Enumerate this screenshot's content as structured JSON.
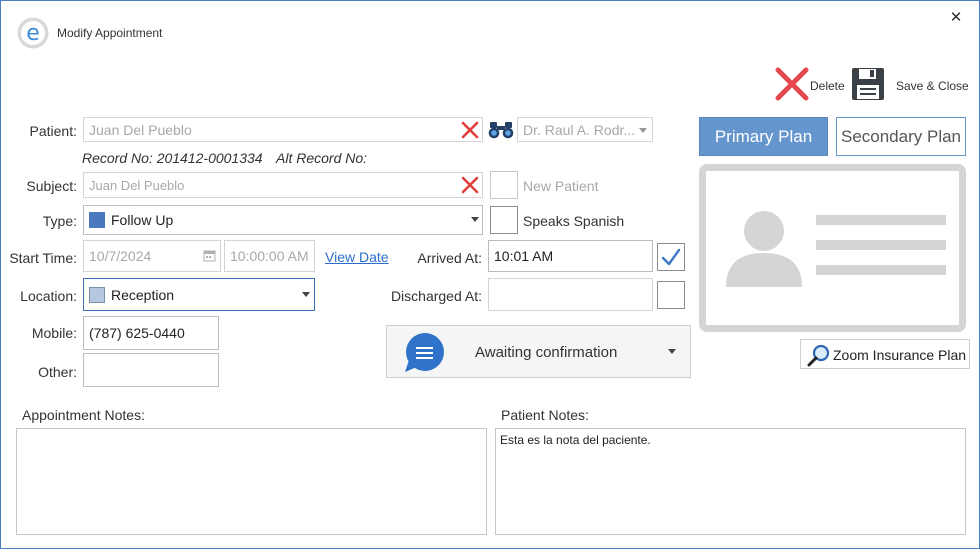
{
  "window": {
    "title": "Modify Appointment",
    "close_glyph": "✕"
  },
  "toolbar": {
    "delete_label": "Delete",
    "save_close_label": "Save & Close"
  },
  "form": {
    "patient_label": "Patient:",
    "patient_value": "Juan Del Pueblo",
    "doctor_value": "Dr. Raul A. Rodr...",
    "record_no": "Record No: 201412-0001334",
    "alt_record_no": "Alt Record No:",
    "subject_label": "Subject:",
    "subject_value": "Juan Del Pueblo",
    "new_patient_label": "New Patient",
    "type_label": "Type:",
    "type_value": "Follow Up",
    "speaks_spanish_label": "Speaks Spanish",
    "start_time_label": "Start Time:",
    "start_date_value": "10/7/2024",
    "start_time_value": "10:00:00 AM",
    "view_date_link": "View Date",
    "arrived_label": "Arrived At:",
    "arrived_value": "10:01 AM",
    "location_label": "Location:",
    "location_value": "Reception",
    "discharged_label": "Discharged At:",
    "discharged_value": "",
    "mobile_label": "Mobile:",
    "mobile_value": "(787) 625-0440",
    "other_label": "Other:",
    "other_value": "",
    "status_value": "Awaiting confirmation"
  },
  "insurance": {
    "primary_tab": "Primary Plan",
    "secondary_tab": "Secondary Plan",
    "zoom_button": "Zoom Insurance Plan"
  },
  "notes": {
    "appointment_label": "Appointment Notes:",
    "appointment_value": "",
    "patient_label": "Patient Notes:",
    "patient_value": "Esta es la nota del paciente."
  },
  "colors": {
    "accent": "#6496cd",
    "type_swatch": "#4a78bf",
    "location_swatch": "#b6c8e0",
    "clear_red": "#e0403c",
    "delete_red": "#e5474f",
    "status_icon": "#2f72c9",
    "link": "#2a6ecb"
  },
  "icons": {
    "app": "app-logo-e-icon",
    "clear": "clear-x-icon",
    "search": "binoculars-icon",
    "calendar": "calendar-icon",
    "checkmark": "checkmark-icon",
    "delete": "delete-x-icon",
    "save": "floppy-disk-icon",
    "status": "chat-bubble-icon",
    "zoom": "magnifier-icon",
    "card": "insurance-card-icon"
  }
}
